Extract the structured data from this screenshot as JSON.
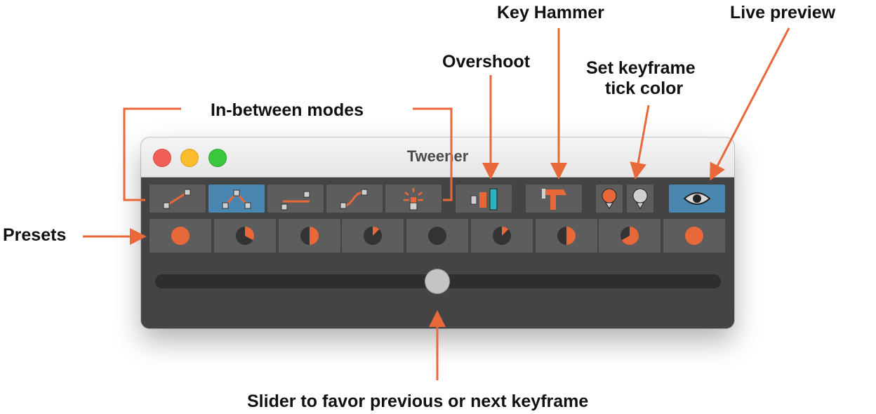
{
  "annotations": {
    "key_hammer": "Key Hammer",
    "live_preview": "Live preview",
    "overshoot": "Overshoot",
    "set_tick_color_line1": "Set keyframe",
    "set_tick_color_line2": "tick color",
    "in_between_modes": "In-between modes",
    "presets": "Presets",
    "slider": "Slider to favor previous or next keyframe"
  },
  "window": {
    "title": "Tweener"
  },
  "toolbar": {
    "modes": [
      {
        "name": "linear",
        "icon": "linear-interp-icon",
        "active": false
      },
      {
        "name": "spline",
        "icon": "spline-interp-icon",
        "active": true
      },
      {
        "name": "step",
        "icon": "step-interp-icon",
        "active": false
      },
      {
        "name": "ease",
        "icon": "ease-interp-icon",
        "active": false
      },
      {
        "name": "flat",
        "icon": "sparkle-key-icon",
        "active": false
      }
    ],
    "overshoot_icon": "overshoot-icon",
    "key_hammer_icon": "hammer-icon",
    "tick_color_icons": [
      "orange-tick-icon",
      "gray-tick-icon"
    ],
    "live_preview_icon": "eye-icon",
    "live_preview_active": true
  },
  "presets": [
    {
      "fill_fraction": 1.0
    },
    {
      "fill_fraction": 0.33
    },
    {
      "fill_fraction": 0.5
    },
    {
      "fill_fraction": 0.125
    },
    {
      "fill_fraction": 0.0
    },
    {
      "fill_fraction": 0.125
    },
    {
      "fill_fraction": 0.5
    },
    {
      "fill_fraction": 0.67
    },
    {
      "fill_fraction": 1.0
    }
  ],
  "slider": {
    "value": 0.5
  },
  "colors": {
    "accent_orange": "#e8683a",
    "active_blue": "#4a87b0",
    "panel_bg": "#444444",
    "button_bg": "#5d5d5d",
    "teal": "#2bb3c0"
  }
}
